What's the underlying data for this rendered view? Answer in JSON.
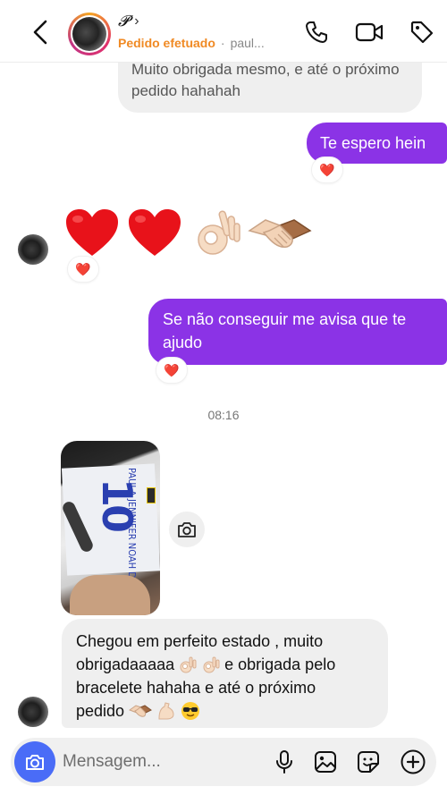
{
  "header": {
    "name": "𝓟",
    "status": "Pedido efetuado",
    "separator": "·",
    "username": "paul...",
    "icons": [
      "back-icon",
      "phone-icon",
      "video-icon",
      "tag-icon"
    ]
  },
  "messages": {
    "prev_in": "Muito obrigada mesmo, e até o próximo pedido hahahah",
    "out1": "Te espero hein",
    "out1_reaction": "❤️",
    "emoji_msg_reaction": "❤️",
    "out2": "Se não conseguir me avisa que te ajudo",
    "out2_reaction": "❤️",
    "timestamp": "08:16",
    "last_in_line1": "Chegou em perfeito estado , muito",
    "last_in_line2": "obrigadaaaaa",
    "last_in_line2b": "e obrigada pelo",
    "last_in_line3": "bracelete hahaha e até o próximo",
    "last_in_line4": "pedido"
  },
  "photo": {
    "shirt_text": "PAULA JENNIFER NOAH DUARTE",
    "shirt_number": "10"
  },
  "composer": {
    "placeholder": "Mensagem...",
    "icons": [
      "camera-icon",
      "mic-icon",
      "gallery-icon",
      "sticker-icon",
      "plus-icon"
    ]
  },
  "colors": {
    "outgoing_bubble": "#8b33e6",
    "incoming_bubble": "#efefef",
    "status_orange": "#f08a24",
    "camera_button": "#4a6cf7"
  }
}
